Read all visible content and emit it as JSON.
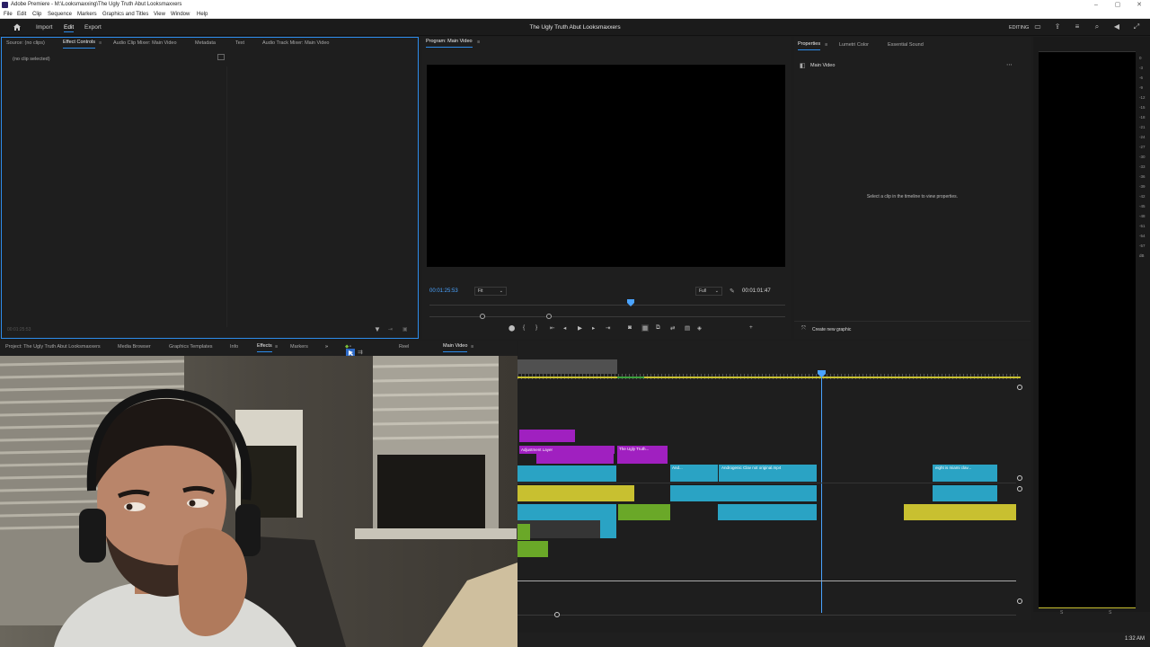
{
  "window": {
    "title": "Adobe Premiere - M:\\Looksmaxxing\\The Ugly Truth Abut Looksmaxxers",
    "controls": [
      "–",
      "▢",
      "✕"
    ]
  },
  "menu": [
    "File",
    "Edit",
    "Clip",
    "Sequence",
    "Markers",
    "Graphics and Titles",
    "View",
    "Window",
    "Help"
  ],
  "header": {
    "workspaces": [
      "Import",
      "Edit",
      "Export"
    ],
    "active_workspace": "Edit",
    "project_title": "The Ugly Truth Abut Looksmaxxers",
    "workspace_label": "EDITING"
  },
  "source_panel": {
    "tabs": [
      "Source: (no clips)",
      "Effect Controls",
      "Audio Clip Mixer: Main Video",
      "Metadata",
      "Text",
      "Audio Track Mixer: Main Video"
    ],
    "active_tab": "Effect Controls",
    "no_clip": "(no clip selected)",
    "timecode": "00:01:25:53"
  },
  "program_panel": {
    "tab": "Program: Main Video",
    "timecode": "00:01:25:53",
    "fit": "Fit",
    "quality": "Full",
    "duration": "00:01:01:47"
  },
  "properties_panel": {
    "tabs": [
      "Properties",
      "Lumetri Color",
      "Essential Sound"
    ],
    "active_tab": "Properties",
    "sequence_name": "Main Video",
    "hint": "Select a clip in the timeline to view properties.",
    "create_graphic": "Create new graphic"
  },
  "project_panel": {
    "tabs": [
      "Project: The Ugly Truth Abut Looksmaxxers",
      "Media Browser",
      "Graphics Templates",
      "Info",
      "Effects",
      "Markers"
    ],
    "active_tab": "Effects"
  },
  "timeline_panel": {
    "tabs": [
      "Reel",
      "Main Video"
    ],
    "active_tab": "Main Video",
    "clips": {
      "adjustment_layer": "Adjustment Layer",
      "title": "The Ugly Truth...",
      "andro_short": "And...",
      "andro": "Androgenic Clav not original.mp4",
      "eight": "eight is miami clav..."
    }
  },
  "audio_meter": {
    "scale": [
      "0",
      "-3",
      "-6",
      "-9",
      "-12",
      "-15",
      "-18",
      "-21",
      "-24",
      "-27",
      "-30",
      "-33",
      "-36",
      "-39",
      "-42",
      "-45",
      "-48",
      "-51",
      "-54",
      "-57",
      "dB"
    ],
    "channels": [
      "S",
      "S"
    ]
  },
  "taskbar": {
    "clock": "1:32 AM"
  },
  "colors": {
    "accent": "#2d8ceb",
    "video_clip": "#2aa3c4",
    "adjustment_clip": "#a020c0",
    "audio_green": "#6aa828",
    "audio_yellow": "#c8c030",
    "playhead": "#4aa3ff"
  }
}
